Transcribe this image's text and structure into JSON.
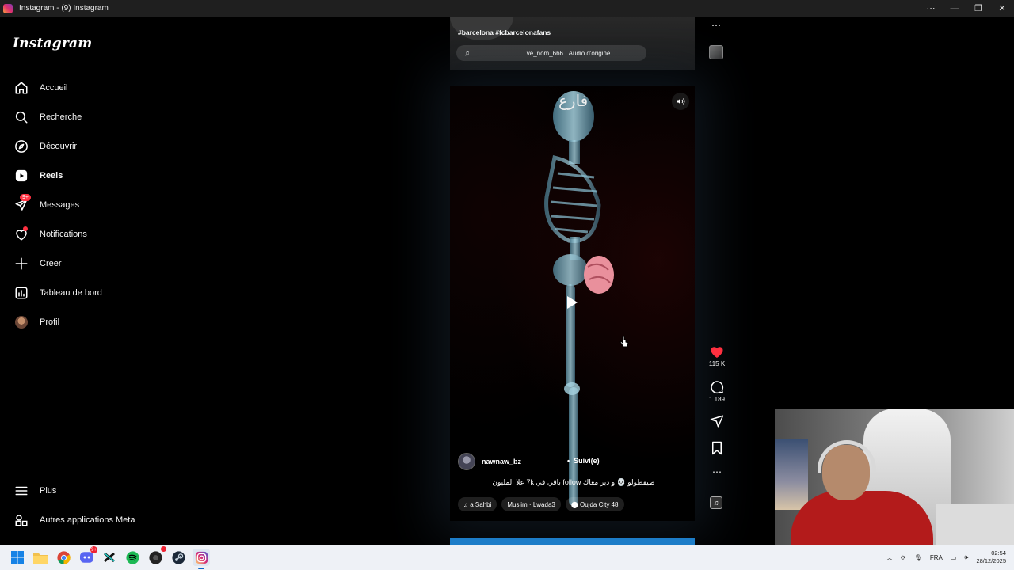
{
  "window": {
    "title": "Instagram - (9) Instagram",
    "controls": [
      "⋯",
      "—",
      "❐",
      "✕"
    ]
  },
  "sidebar": {
    "logo": "Instagram",
    "items": [
      {
        "label": "Accueil",
        "icon": "home-icon"
      },
      {
        "label": "Recherche",
        "icon": "search-icon"
      },
      {
        "label": "Découvrir",
        "icon": "compass-icon"
      },
      {
        "label": "Reels",
        "icon": "reels-icon",
        "active": true
      },
      {
        "label": "Messages",
        "icon": "messages-icon",
        "badge": "9+"
      },
      {
        "label": "Notifications",
        "icon": "heart-icon",
        "dot": true
      },
      {
        "label": "Créer",
        "icon": "plus-icon"
      },
      {
        "label": "Tableau de bord",
        "icon": "dashboard-icon"
      },
      {
        "label": "Profil",
        "icon": "avatar"
      }
    ],
    "bottom": [
      {
        "label": "Plus",
        "icon": "menu-icon"
      },
      {
        "label": "Autres applications Meta",
        "icon": "meta-apps-icon"
      }
    ]
  },
  "top_reel": {
    "hashtags": "#barcelona #fcbarcelonafans",
    "audio": "ve_nom_666 · Audio d'origine"
  },
  "reel": {
    "overlay_text": "فارغ",
    "author": "nawnaw_bz",
    "follow_state": "Suivi(e)",
    "caption": "صيفطولو 💀 و دير معاك follow باقي في 7k علا المليون",
    "music_artist": "a Sahbi",
    "music_title": "Muslim · Lwada3",
    "location": "Oujda City 48",
    "likes": "115 K",
    "comments": "1 189"
  },
  "taskbar": {
    "apps": [
      "windows-start",
      "file-explorer",
      "chrome",
      "discord",
      "capcut",
      "spotify",
      "steam-game",
      "steam",
      "instagram"
    ],
    "discord_badge": "9+",
    "language": "FRA",
    "time": "02:54",
    "date": "28/12/2025"
  },
  "colors": {
    "accent_red": "#ff3040",
    "like_red": "#ff3040",
    "taskbar": "#eef1f6"
  }
}
